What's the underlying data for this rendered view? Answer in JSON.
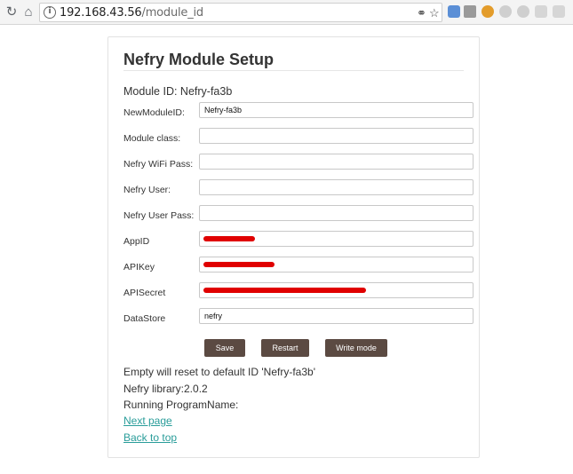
{
  "browser": {
    "url_host": "192.168.43.56",
    "url_path": "/module_id"
  },
  "page": {
    "title": "Nefry Module Setup",
    "module_id_text": "Module ID: Nefry-fa3b"
  },
  "form": {
    "fields": [
      {
        "label": "NewModuleID:",
        "value": ""
      },
      {
        "label": "Module class:",
        "value": ""
      },
      {
        "label": "Nefry WiFi Pass:",
        "value": ""
      },
      {
        "label": "Nefry User:",
        "value": ""
      },
      {
        "label": "Nefry User Pass:",
        "value": ""
      },
      {
        "label": "AppID",
        "value": ""
      },
      {
        "label": "APIKey",
        "value": ""
      },
      {
        "label": "APISecret",
        "value": ""
      },
      {
        "label": "DataStore",
        "value": "nefry"
      }
    ],
    "new_module_id_value": "Nefry-fa3b"
  },
  "buttons": {
    "save": "Save",
    "restart": "Restart",
    "write_mode": "Write mode"
  },
  "info": {
    "reset_note": "Empty will reset to default ID 'Nefry-fa3b'",
    "library": "Nefry library:2.0.2",
    "program": "Running ProgramName:"
  },
  "links": {
    "next_page": "Next page",
    "back_to_top": "Back to top"
  },
  "colors": {
    "button_bg": "#5b4a42",
    "link": "#2a9d9a",
    "redaction": "#e00000"
  }
}
